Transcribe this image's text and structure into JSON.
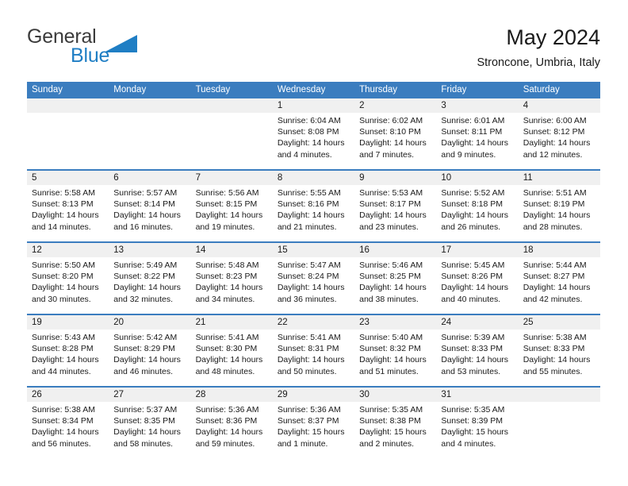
{
  "brand": {
    "name_part1": "General",
    "name_part2": "Blue",
    "triangle_color": "#1f7ec4",
    "icon": "triangle-logo-icon"
  },
  "header": {
    "title": "May 2024",
    "subtitle": "Stroncone, Umbria, Italy"
  },
  "theme": {
    "header_blue": "#3b7dbf",
    "row_strip_gray": "#f0f0f0",
    "text": "#1a1a1a"
  },
  "weekdays": [
    "Sunday",
    "Monday",
    "Tuesday",
    "Wednesday",
    "Thursday",
    "Friday",
    "Saturday"
  ],
  "labels": {
    "sunrise": "Sunrise:",
    "sunset": "Sunset:",
    "daylight": "Daylight:"
  },
  "weeks": [
    [
      {
        "day": "",
        "lines": []
      },
      {
        "day": "",
        "lines": []
      },
      {
        "day": "",
        "lines": []
      },
      {
        "day": "1",
        "lines": [
          "Sunrise: 6:04 AM",
          "Sunset: 8:08 PM",
          "Daylight: 14 hours",
          "and 4 minutes."
        ]
      },
      {
        "day": "2",
        "lines": [
          "Sunrise: 6:02 AM",
          "Sunset: 8:10 PM",
          "Daylight: 14 hours",
          "and 7 minutes."
        ]
      },
      {
        "day": "3",
        "lines": [
          "Sunrise: 6:01 AM",
          "Sunset: 8:11 PM",
          "Daylight: 14 hours",
          "and 9 minutes."
        ]
      },
      {
        "day": "4",
        "lines": [
          "Sunrise: 6:00 AM",
          "Sunset: 8:12 PM",
          "Daylight: 14 hours",
          "and 12 minutes."
        ]
      }
    ],
    [
      {
        "day": "5",
        "lines": [
          "Sunrise: 5:58 AM",
          "Sunset: 8:13 PM",
          "Daylight: 14 hours",
          "and 14 minutes."
        ]
      },
      {
        "day": "6",
        "lines": [
          "Sunrise: 5:57 AM",
          "Sunset: 8:14 PM",
          "Daylight: 14 hours",
          "and 16 minutes."
        ]
      },
      {
        "day": "7",
        "lines": [
          "Sunrise: 5:56 AM",
          "Sunset: 8:15 PM",
          "Daylight: 14 hours",
          "and 19 minutes."
        ]
      },
      {
        "day": "8",
        "lines": [
          "Sunrise: 5:55 AM",
          "Sunset: 8:16 PM",
          "Daylight: 14 hours",
          "and 21 minutes."
        ]
      },
      {
        "day": "9",
        "lines": [
          "Sunrise: 5:53 AM",
          "Sunset: 8:17 PM",
          "Daylight: 14 hours",
          "and 23 minutes."
        ]
      },
      {
        "day": "10",
        "lines": [
          "Sunrise: 5:52 AM",
          "Sunset: 8:18 PM",
          "Daylight: 14 hours",
          "and 26 minutes."
        ]
      },
      {
        "day": "11",
        "lines": [
          "Sunrise: 5:51 AM",
          "Sunset: 8:19 PM",
          "Daylight: 14 hours",
          "and 28 minutes."
        ]
      }
    ],
    [
      {
        "day": "12",
        "lines": [
          "Sunrise: 5:50 AM",
          "Sunset: 8:20 PM",
          "Daylight: 14 hours",
          "and 30 minutes."
        ]
      },
      {
        "day": "13",
        "lines": [
          "Sunrise: 5:49 AM",
          "Sunset: 8:22 PM",
          "Daylight: 14 hours",
          "and 32 minutes."
        ]
      },
      {
        "day": "14",
        "lines": [
          "Sunrise: 5:48 AM",
          "Sunset: 8:23 PM",
          "Daylight: 14 hours",
          "and 34 minutes."
        ]
      },
      {
        "day": "15",
        "lines": [
          "Sunrise: 5:47 AM",
          "Sunset: 8:24 PM",
          "Daylight: 14 hours",
          "and 36 minutes."
        ]
      },
      {
        "day": "16",
        "lines": [
          "Sunrise: 5:46 AM",
          "Sunset: 8:25 PM",
          "Daylight: 14 hours",
          "and 38 minutes."
        ]
      },
      {
        "day": "17",
        "lines": [
          "Sunrise: 5:45 AM",
          "Sunset: 8:26 PM",
          "Daylight: 14 hours",
          "and 40 minutes."
        ]
      },
      {
        "day": "18",
        "lines": [
          "Sunrise: 5:44 AM",
          "Sunset: 8:27 PM",
          "Daylight: 14 hours",
          "and 42 minutes."
        ]
      }
    ],
    [
      {
        "day": "19",
        "lines": [
          "Sunrise: 5:43 AM",
          "Sunset: 8:28 PM",
          "Daylight: 14 hours",
          "and 44 minutes."
        ]
      },
      {
        "day": "20",
        "lines": [
          "Sunrise: 5:42 AM",
          "Sunset: 8:29 PM",
          "Daylight: 14 hours",
          "and 46 minutes."
        ]
      },
      {
        "day": "21",
        "lines": [
          "Sunrise: 5:41 AM",
          "Sunset: 8:30 PM",
          "Daylight: 14 hours",
          "and 48 minutes."
        ]
      },
      {
        "day": "22",
        "lines": [
          "Sunrise: 5:41 AM",
          "Sunset: 8:31 PM",
          "Daylight: 14 hours",
          "and 50 minutes."
        ]
      },
      {
        "day": "23",
        "lines": [
          "Sunrise: 5:40 AM",
          "Sunset: 8:32 PM",
          "Daylight: 14 hours",
          "and 51 minutes."
        ]
      },
      {
        "day": "24",
        "lines": [
          "Sunrise: 5:39 AM",
          "Sunset: 8:33 PM",
          "Daylight: 14 hours",
          "and 53 minutes."
        ]
      },
      {
        "day": "25",
        "lines": [
          "Sunrise: 5:38 AM",
          "Sunset: 8:33 PM",
          "Daylight: 14 hours",
          "and 55 minutes."
        ]
      }
    ],
    [
      {
        "day": "26",
        "lines": [
          "Sunrise: 5:38 AM",
          "Sunset: 8:34 PM",
          "Daylight: 14 hours",
          "and 56 minutes."
        ]
      },
      {
        "day": "27",
        "lines": [
          "Sunrise: 5:37 AM",
          "Sunset: 8:35 PM",
          "Daylight: 14 hours",
          "and 58 minutes."
        ]
      },
      {
        "day": "28",
        "lines": [
          "Sunrise: 5:36 AM",
          "Sunset: 8:36 PM",
          "Daylight: 14 hours",
          "and 59 minutes."
        ]
      },
      {
        "day": "29",
        "lines": [
          "Sunrise: 5:36 AM",
          "Sunset: 8:37 PM",
          "Daylight: 15 hours",
          "and 1 minute."
        ]
      },
      {
        "day": "30",
        "lines": [
          "Sunrise: 5:35 AM",
          "Sunset: 8:38 PM",
          "Daylight: 15 hours",
          "and 2 minutes."
        ]
      },
      {
        "day": "31",
        "lines": [
          "Sunrise: 5:35 AM",
          "Sunset: 8:39 PM",
          "Daylight: 15 hours",
          "and 4 minutes."
        ]
      },
      {
        "day": "",
        "lines": []
      }
    ]
  ]
}
